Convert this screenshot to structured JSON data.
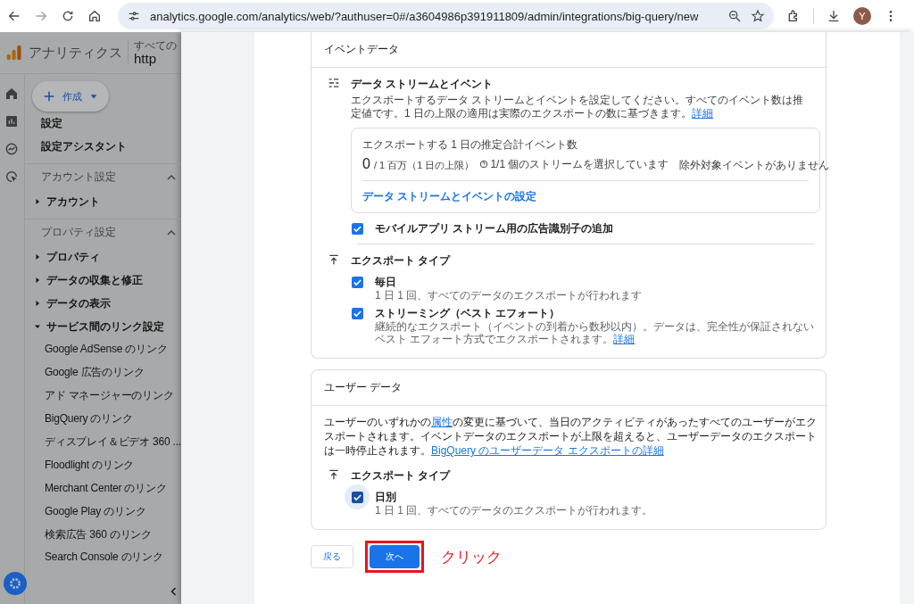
{
  "browser": {
    "url": "analytics.google.com/analytics/web/?authuser=0#/a3604986p391911809/admin/integrations/big-query/new",
    "avatar": "Y"
  },
  "app": {
    "title": "アナリティクス",
    "account_label": "すべての",
    "property": "http"
  },
  "create_button": "作成",
  "nav": [
    {
      "kind": "item",
      "label": "設定"
    },
    {
      "kind": "item",
      "label": "設定アシスタント"
    },
    {
      "kind": "section",
      "label": "アカウント設定",
      "expanded": true,
      "children": [
        {
          "kind": "group",
          "label": "アカウント",
          "expanded": false
        }
      ]
    },
    {
      "kind": "section",
      "label": "プロパティ設定",
      "expanded": true,
      "children": [
        {
          "kind": "group",
          "label": "プロパティ",
          "expanded": false
        },
        {
          "kind": "group",
          "label": "データの収集と修正",
          "expanded": false
        },
        {
          "kind": "group",
          "label": "データの表示",
          "expanded": false
        },
        {
          "kind": "group",
          "label": "サービス間のリンク設定",
          "expanded": true,
          "children": [
            {
              "kind": "link",
              "label": "Google AdSense のリンク"
            },
            {
              "kind": "link",
              "label": "Google 広告のリンク"
            },
            {
              "kind": "link",
              "label": "アド マネージャーのリンク"
            },
            {
              "kind": "link",
              "label": "BigQuery のリンク"
            },
            {
              "kind": "link",
              "label": "ディスプレイ＆ビデオ 360 ..."
            },
            {
              "kind": "link",
              "label": "Floodlight のリンク"
            },
            {
              "kind": "link",
              "label": "Merchant Center のリンク"
            },
            {
              "kind": "link",
              "label": "Google Play のリンク"
            },
            {
              "kind": "link",
              "label": "検索広告 360 のリンク"
            },
            {
              "kind": "link",
              "label": "Search Console のリンク"
            }
          ]
        }
      ]
    }
  ],
  "event_card": {
    "title": "イベントデータ",
    "streams": {
      "heading": "データ ストリームとイベント",
      "description": [
        {
          "kind": "text",
          "text": "エクスポートするデータ ストリームとイベントを設定してください。すべてのイベント数は推定値です。1 日の上限の適用は実際のエクスポートの数に基づきます。"
        },
        {
          "kind": "link",
          "text": "詳細"
        }
      ]
    },
    "summary": {
      "label": "エクスポートする 1 日の推定合計イベント数",
      "count": "0",
      "limit": "/ 1 百万（1 日の上限）",
      "streams": "1/1 個のストリームを選択しています",
      "excluded": "除外対象イベントがありません",
      "settings_link": "データ ストリームとイベントの設定"
    },
    "ad_id": {
      "label": "モバイルアプリ ストリーム用の広告識別子の追加",
      "checked": true
    },
    "export": {
      "heading": "エクスポート タイプ",
      "options": [
        {
          "label": "毎日",
          "description": [
            {
              "kind": "text",
              "text": "1 日 1 回、すべてのデータのエクスポートが行われます"
            }
          ],
          "checked": true,
          "focused": false
        },
        {
          "label": "ストリーミング（ベスト エフォート）",
          "description": [
            {
              "kind": "text",
              "text": "継続的なエクスポート（イベントの到着から数秒以内）。データは、完全性が保証されないベスト エフォート方式でエクスポートされます。"
            },
            {
              "kind": "link",
              "text": "詳細"
            }
          ],
          "checked": true,
          "focused": false
        }
      ]
    }
  },
  "user_card": {
    "title": "ユーザー データ",
    "description": [
      {
        "kind": "text",
        "text": "ユーザーのいずれかの"
      },
      {
        "kind": "link",
        "text": "属性"
      },
      {
        "kind": "text",
        "text": "の変更に基づいて、当日のアクティビティがあったすべてのユーザーがエクスポートされます。イベントデータのエクスポートが上限を超えると、ユーザーデータのエクスポートは一時停止されます。"
      },
      {
        "kind": "link",
        "text": "BigQuery のユーザーデータ エクスポートの詳細"
      }
    ],
    "export": {
      "heading": "エクスポート タイプ",
      "options": [
        {
          "label": "日別",
          "description": [
            {
              "kind": "text",
              "text": "1 日 1 回、すべてのデータのエクスポートが行われます。"
            }
          ],
          "checked": true,
          "focused": true
        }
      ]
    }
  },
  "buttons": {
    "back": "戻る",
    "next": "次へ"
  },
  "annotation": {
    "text": "クリック"
  }
}
